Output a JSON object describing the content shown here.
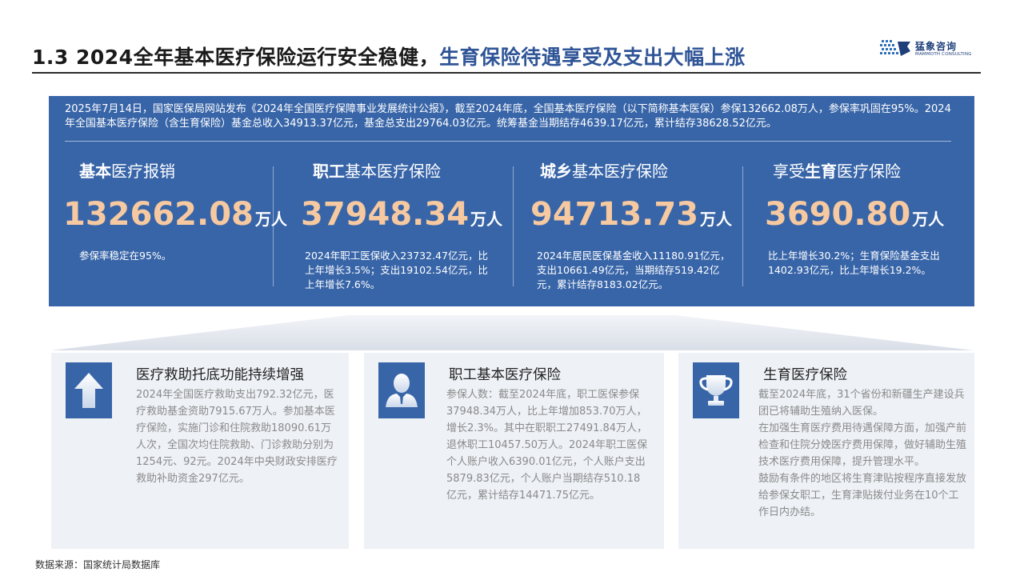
{
  "header": {
    "title_main": "1.3 2024全年基本医疗保险运行安全稳健，",
    "title_accent": "生育保险待遇享受及支出大幅上涨",
    "logo_cn": "猛象咨询",
    "logo_en": "MAMMOTH CONSULTING"
  },
  "panel": {
    "intro": "2025年7月14日，国家医保局网站发布《2024年全国医疗保障事业发展统计公报》，截至2024年底，全国基本医疗保险（以下简称基本医保）参保132662.08万人，参保率巩固在95%。2024年全国基本医疗保险（含生育保险）基金总收入34913.37亿元，基金总支出29764.03亿元。统筹基金当期结存4639.17亿元，累计结存38628.52亿元。",
    "stats": [
      {
        "title_bold": "基本",
        "title_rest": "医疗报销",
        "value": "132662.08",
        "unit": "万人",
        "desc": "参保率稳定在95%。"
      },
      {
        "title_bold": "职工",
        "title_rest": "基本医疗保险",
        "value": "37948.34",
        "unit": "万人",
        "desc": "2024年职工医保收入23732.47亿元，比上年增长3.5%；支出19102.54亿元，比上年增长7.6%。"
      },
      {
        "title_bold": "城乡",
        "title_rest": "基本医疗保险",
        "value": "94713.73",
        "unit": "万人",
        "desc": "2024年居民医保基金收入11180.91亿元，支出10661.49亿元，当期结存519.42亿元，累计结存8183.02亿元。"
      },
      {
        "title_pre": "享受",
        "title_bold": "生育",
        "title_rest": "医疗保险",
        "value": "3690.80",
        "unit": "万人",
        "desc": "比上年增长30.2%；生育保险基金支出1402.93亿元，比上年增长19.2%。"
      }
    ]
  },
  "cards": [
    {
      "icon": "arrow-up-icon",
      "title": "医疗救助托底功能持续增强",
      "paragraphs": [
        "2024年全国医疗救助支出792.32亿元，医疗救助基金资助7915.67万人。参加基本医疗保险，实施门诊和住院救助18090.61万人次，全国次均住院救助、门诊救助分别为1254元、92元。2024年中央财政安排医疗救助补助资金297亿元。"
      ]
    },
    {
      "icon": "person-icon",
      "title": "职工基本医疗保险",
      "paragraphs": [
        "参保人数：截至2024年底，职工医保参保37948.34万人，比上年增加853.70万人，增长2.3%。其中在职职工27491.84万人，退休职工10457.50万人。2024年职工医保个人账户收入6390.01亿元，个人账户支出5879.83亿元，个人账户当期结存510.18亿元，累计结存14471.75亿元。"
      ]
    },
    {
      "icon": "trophy-icon",
      "title": "生育医疗保险",
      "paragraphs": [
        "截至2024年底，31个省份和新疆生产建设兵团已将辅助生殖纳入医保。",
        "在加强生育医疗费用待遇保障方面，加强产前检查和住院分娩医疗费用保障，做好辅助生殖技术医疗费用保障，提升管理水平。",
        "鼓励有条件的地区将生育津贴按程序直接发放给参保女职工，生育津贴拨付业务在10个工作日内办结。"
      ]
    }
  ],
  "footer": {
    "source": "数据来源：国家统计局数据库"
  }
}
